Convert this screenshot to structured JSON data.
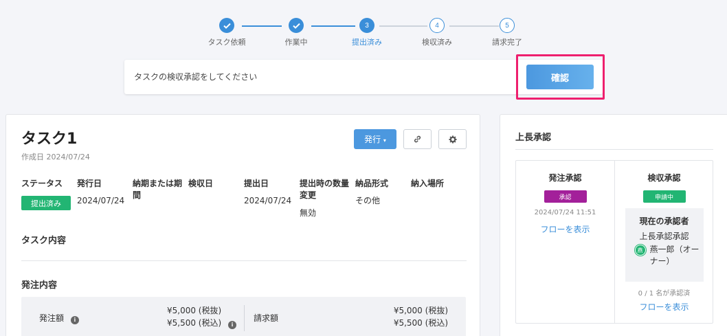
{
  "stepper": {
    "steps": [
      {
        "num": "1",
        "label": "タスク依頼",
        "state": "done"
      },
      {
        "num": "2",
        "label": "作業中",
        "state": "done"
      },
      {
        "num": "3",
        "label": "提出済み",
        "state": "current"
      },
      {
        "num": "4",
        "label": "検収済み",
        "state": "todo"
      },
      {
        "num": "5",
        "label": "請求完了",
        "state": "todo"
      }
    ]
  },
  "banner": {
    "message": "タスクの検収承認をしてください",
    "confirm_label": "確認"
  },
  "task": {
    "title": "タスク1",
    "created": "作成日 2024/07/24",
    "issue_label": "発行",
    "fields": {
      "status_h": "ステータス",
      "status_v": "提出済み",
      "issue_date_h": "発行日",
      "issue_date_v": "2024/07/24",
      "deadline_h": "納期または期間",
      "inspect_h": "検収日",
      "submit_h": "提出日",
      "submit_v": "2024/07/24",
      "qty_change_h": "提出時の数量変更",
      "qty_change_v": "無効",
      "format_h": "納品形式",
      "format_v": "その他",
      "place_h": "納入場所"
    },
    "content_h": "タスク内容",
    "order_h": "発注内容",
    "order": {
      "order_amount_label": "発注額",
      "order_ex_tax": "¥5,000 (税抜)",
      "order_in_tax": "¥5,500 (税込)",
      "invoice_label": "請求額",
      "invoice_ex_tax": "¥5,000 (税抜)",
      "invoice_in_tax": "¥5,500 (税込)"
    }
  },
  "approval": {
    "title": "上長承認",
    "order": {
      "heading": "発注承認",
      "badge": "承認",
      "time": "2024/07/24 11:51",
      "flow_link": "フローを表示"
    },
    "inspection": {
      "heading": "検収承認",
      "badge": "申請中",
      "current_h": "現在の承認者",
      "role": "上長承認承認",
      "avatar_char": "燕",
      "user": "燕一郎（オーナー）",
      "count": "0 / 1 名が承認済",
      "flow_link": "フローを表示"
    }
  },
  "colors": {
    "accent": "#3a8ed9",
    "success": "#22b573",
    "approved": "#a3209a",
    "highlight": "#ee1f6e"
  }
}
